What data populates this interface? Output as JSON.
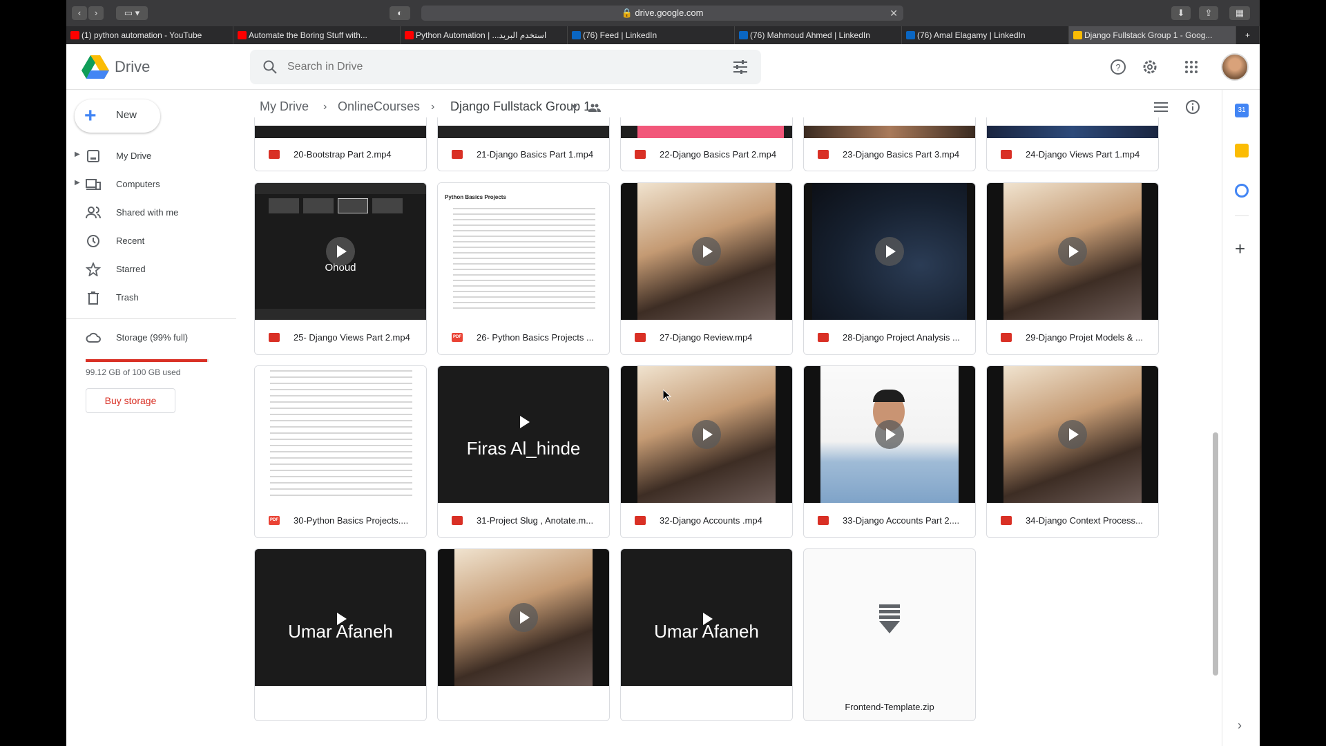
{
  "browser": {
    "url": "drive.google.com",
    "tabs": [
      {
        "label": "(1) python automation - YouTube",
        "color": "#ff0000"
      },
      {
        "label": "Automate the Boring Stuff with...",
        "color": "#ff0000"
      },
      {
        "label": "Python Automation | ...استخدم البريد",
        "color": "#ff0000"
      },
      {
        "label": "(76) Feed | LinkedIn",
        "color": "#0a66c2"
      },
      {
        "label": "(76) Mahmoud Ahmed | LinkedIn",
        "color": "#0a66c2"
      },
      {
        "label": "(76) Amal Elagamy | LinkedIn",
        "color": "#0a66c2"
      },
      {
        "label": "Django Fullstack Group 1 - Goog...",
        "color": "#fbbc04"
      }
    ]
  },
  "header": {
    "app_name": "Drive",
    "search_placeholder": "Search in Drive"
  },
  "sidebar": {
    "new_label": "New",
    "items": [
      {
        "label": "My Drive",
        "icon": "my-drive-icon"
      },
      {
        "label": "Computers",
        "icon": "computers-icon"
      },
      {
        "label": "Shared with me",
        "icon": "shared-icon"
      },
      {
        "label": "Recent",
        "icon": "clock-icon"
      },
      {
        "label": "Starred",
        "icon": "star-icon"
      },
      {
        "label": "Trash",
        "icon": "trash-icon"
      }
    ],
    "storage_label": "Storage (99% full)",
    "storage_used_text": "99.12 GB of 100 GB used",
    "storage_fraction": 0.99,
    "buy_label": "Buy storage"
  },
  "breadcrumb": {
    "root": "My Drive",
    "middle": "OnlineCourses",
    "current": "Django Fullstack Group 1"
  },
  "files": {
    "row_top": [
      "20-Bootstrap Part 2.mp4",
      "21-Django Basics Part 1.mp4",
      "22-Django Basics Part 2.mp4",
      "23-Django Basics Part 3.mp4",
      "24-Django Views Part 1.mp4"
    ],
    "row_1": [
      {
        "name": "25- Django Views Part 2.mp4",
        "type": "video",
        "thumb_text": "Ohoud"
      },
      {
        "name": "26- Python Basics Projects ...",
        "type": "pdf",
        "thumb_title": "Python Basics Projects"
      },
      {
        "name": "27-Django Review.mp4",
        "type": "video"
      },
      {
        "name": "28-Django Project Analysis ...",
        "type": "video"
      },
      {
        "name": "29-Django Projet Models & ...",
        "type": "video"
      }
    ],
    "row_2": [
      {
        "name": "30-Python Basics Projects....",
        "type": "pdf"
      },
      {
        "name": "31-Project Slug , Anotate.m...",
        "type": "video",
        "thumb_text": "Firas Al_hinde"
      },
      {
        "name": "32-Django Accounts .mp4",
        "type": "video"
      },
      {
        "name": "33-Django Accounts Part 2....",
        "type": "video"
      },
      {
        "name": "34-Django Context Process...",
        "type": "video"
      }
    ],
    "row_3": [
      {
        "name": "",
        "type": "video",
        "thumb_text": "Umar Afaneh"
      },
      {
        "name": "",
        "type": "video"
      },
      {
        "name": "",
        "type": "video",
        "thumb_text": "Umar Afaneh"
      },
      {
        "name": "Frontend-Template.zip",
        "type": "zip"
      }
    ]
  },
  "colors": {
    "accent_red": "#d93025",
    "drive_blue": "#4285f4",
    "drive_green": "#0f9d58",
    "drive_yellow": "#fbbc04"
  }
}
